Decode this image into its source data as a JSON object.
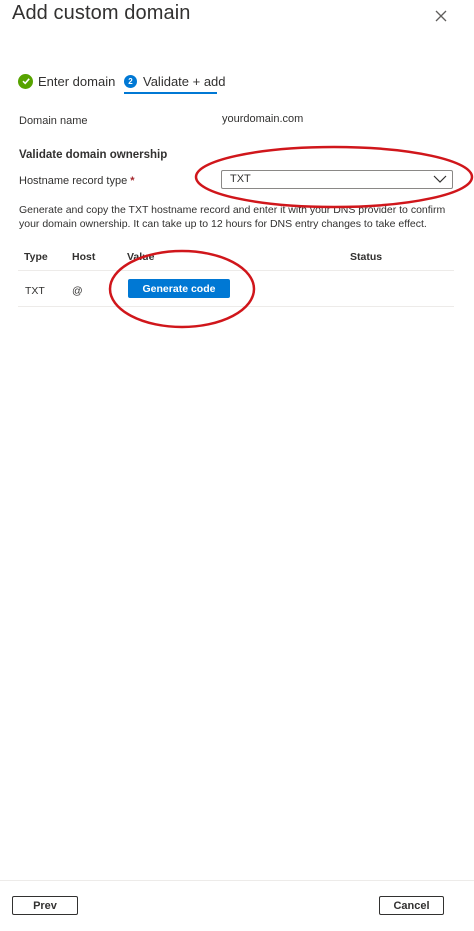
{
  "panel": {
    "title": "Add custom domain",
    "close_icon": "close-icon"
  },
  "steps": [
    {
      "label": "Enter domain",
      "state": "complete",
      "icon": "check-circle-icon"
    },
    {
      "label": "Validate + add",
      "state": "current",
      "number": "2"
    }
  ],
  "domain": {
    "label": "Domain name",
    "value": "yourdomain.com"
  },
  "validate": {
    "heading": "Validate domain ownership",
    "hostname_label": "Hostname record type",
    "required_mark": "*",
    "selected": "TXT",
    "description": "Generate and copy the TXT hostname record and enter it with your DNS provider to confirm your domain ownership. It can take up to 12 hours for DNS entry changes to take effect."
  },
  "table": {
    "headers": [
      "Type",
      "Host",
      "Value",
      "Status"
    ],
    "rows": [
      {
        "type": "TXT",
        "host": "@",
        "action": "Generate code"
      }
    ]
  },
  "footer": {
    "prev_label": "Prev",
    "cancel_label": "Cancel"
  },
  "colors": {
    "accent": "#0078d4",
    "success": "#57a300",
    "annotation": "#d0161b"
  }
}
